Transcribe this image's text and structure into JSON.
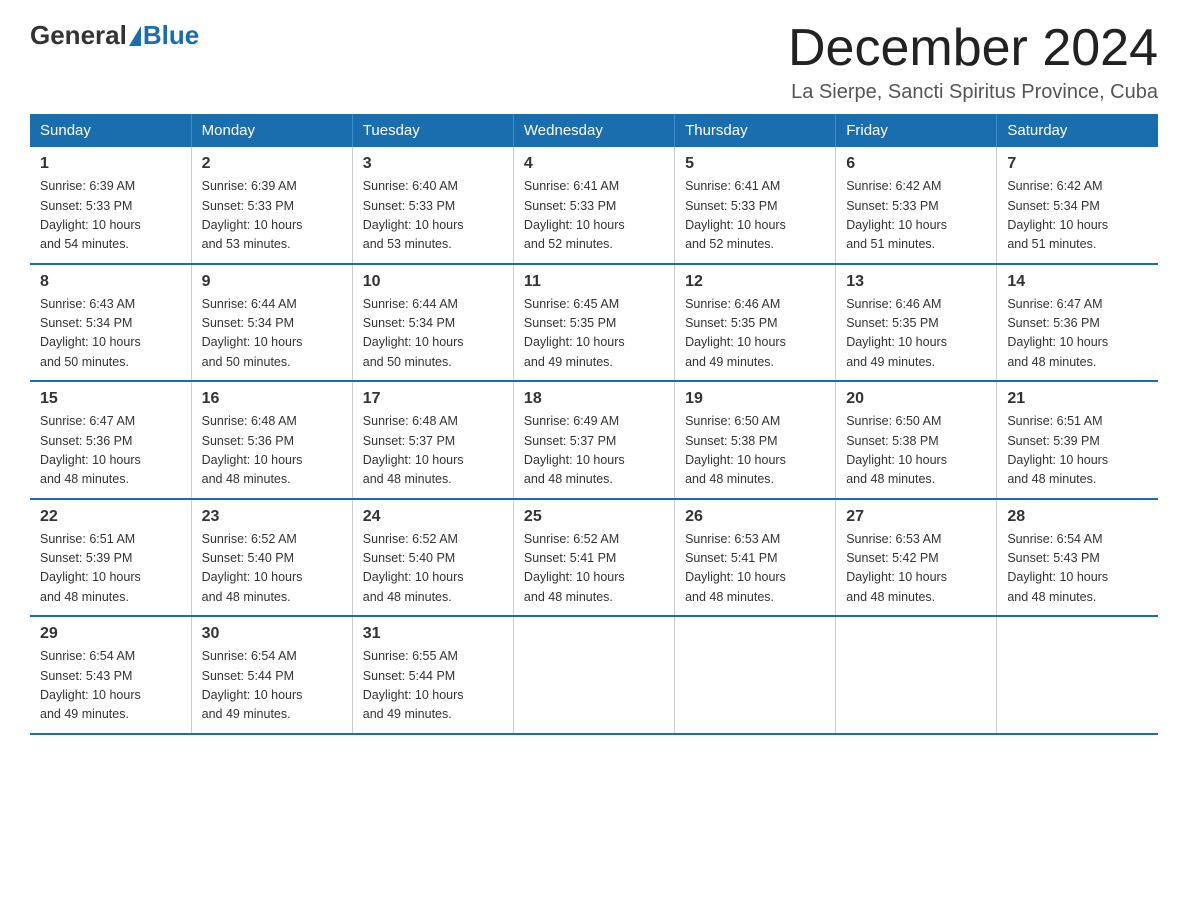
{
  "logo": {
    "general": "General",
    "blue": "Blue"
  },
  "title": "December 2024",
  "location": "La Sierpe, Sancti Spiritus Province, Cuba",
  "days_of_week": [
    "Sunday",
    "Monday",
    "Tuesday",
    "Wednesday",
    "Thursday",
    "Friday",
    "Saturday"
  ],
  "weeks": [
    [
      {
        "day": "1",
        "sunrise": "6:39 AM",
        "sunset": "5:33 PM",
        "daylight": "10 hours and 54 minutes."
      },
      {
        "day": "2",
        "sunrise": "6:39 AM",
        "sunset": "5:33 PM",
        "daylight": "10 hours and 53 minutes."
      },
      {
        "day": "3",
        "sunrise": "6:40 AM",
        "sunset": "5:33 PM",
        "daylight": "10 hours and 53 minutes."
      },
      {
        "day": "4",
        "sunrise": "6:41 AM",
        "sunset": "5:33 PM",
        "daylight": "10 hours and 52 minutes."
      },
      {
        "day": "5",
        "sunrise": "6:41 AM",
        "sunset": "5:33 PM",
        "daylight": "10 hours and 52 minutes."
      },
      {
        "day": "6",
        "sunrise": "6:42 AM",
        "sunset": "5:33 PM",
        "daylight": "10 hours and 51 minutes."
      },
      {
        "day": "7",
        "sunrise": "6:42 AM",
        "sunset": "5:34 PM",
        "daylight": "10 hours and 51 minutes."
      }
    ],
    [
      {
        "day": "8",
        "sunrise": "6:43 AM",
        "sunset": "5:34 PM",
        "daylight": "10 hours and 50 minutes."
      },
      {
        "day": "9",
        "sunrise": "6:44 AM",
        "sunset": "5:34 PM",
        "daylight": "10 hours and 50 minutes."
      },
      {
        "day": "10",
        "sunrise": "6:44 AM",
        "sunset": "5:34 PM",
        "daylight": "10 hours and 50 minutes."
      },
      {
        "day": "11",
        "sunrise": "6:45 AM",
        "sunset": "5:35 PM",
        "daylight": "10 hours and 49 minutes."
      },
      {
        "day": "12",
        "sunrise": "6:46 AM",
        "sunset": "5:35 PM",
        "daylight": "10 hours and 49 minutes."
      },
      {
        "day": "13",
        "sunrise": "6:46 AM",
        "sunset": "5:35 PM",
        "daylight": "10 hours and 49 minutes."
      },
      {
        "day": "14",
        "sunrise": "6:47 AM",
        "sunset": "5:36 PM",
        "daylight": "10 hours and 48 minutes."
      }
    ],
    [
      {
        "day": "15",
        "sunrise": "6:47 AM",
        "sunset": "5:36 PM",
        "daylight": "10 hours and 48 minutes."
      },
      {
        "day": "16",
        "sunrise": "6:48 AM",
        "sunset": "5:36 PM",
        "daylight": "10 hours and 48 minutes."
      },
      {
        "day": "17",
        "sunrise": "6:48 AM",
        "sunset": "5:37 PM",
        "daylight": "10 hours and 48 minutes."
      },
      {
        "day": "18",
        "sunrise": "6:49 AM",
        "sunset": "5:37 PM",
        "daylight": "10 hours and 48 minutes."
      },
      {
        "day": "19",
        "sunrise": "6:50 AM",
        "sunset": "5:38 PM",
        "daylight": "10 hours and 48 minutes."
      },
      {
        "day": "20",
        "sunrise": "6:50 AM",
        "sunset": "5:38 PM",
        "daylight": "10 hours and 48 minutes."
      },
      {
        "day": "21",
        "sunrise": "6:51 AM",
        "sunset": "5:39 PM",
        "daylight": "10 hours and 48 minutes."
      }
    ],
    [
      {
        "day": "22",
        "sunrise": "6:51 AM",
        "sunset": "5:39 PM",
        "daylight": "10 hours and 48 minutes."
      },
      {
        "day": "23",
        "sunrise": "6:52 AM",
        "sunset": "5:40 PM",
        "daylight": "10 hours and 48 minutes."
      },
      {
        "day": "24",
        "sunrise": "6:52 AM",
        "sunset": "5:40 PM",
        "daylight": "10 hours and 48 minutes."
      },
      {
        "day": "25",
        "sunrise": "6:52 AM",
        "sunset": "5:41 PM",
        "daylight": "10 hours and 48 minutes."
      },
      {
        "day": "26",
        "sunrise": "6:53 AM",
        "sunset": "5:41 PM",
        "daylight": "10 hours and 48 minutes."
      },
      {
        "day": "27",
        "sunrise": "6:53 AM",
        "sunset": "5:42 PM",
        "daylight": "10 hours and 48 minutes."
      },
      {
        "day": "28",
        "sunrise": "6:54 AM",
        "sunset": "5:43 PM",
        "daylight": "10 hours and 48 minutes."
      }
    ],
    [
      {
        "day": "29",
        "sunrise": "6:54 AM",
        "sunset": "5:43 PM",
        "daylight": "10 hours and 49 minutes."
      },
      {
        "day": "30",
        "sunrise": "6:54 AM",
        "sunset": "5:44 PM",
        "daylight": "10 hours and 49 minutes."
      },
      {
        "day": "31",
        "sunrise": "6:55 AM",
        "sunset": "5:44 PM",
        "daylight": "10 hours and 49 minutes."
      },
      null,
      null,
      null,
      null
    ]
  ],
  "labels": {
    "sunrise": "Sunrise:",
    "sunset": "Sunset:",
    "daylight": "Daylight:"
  }
}
